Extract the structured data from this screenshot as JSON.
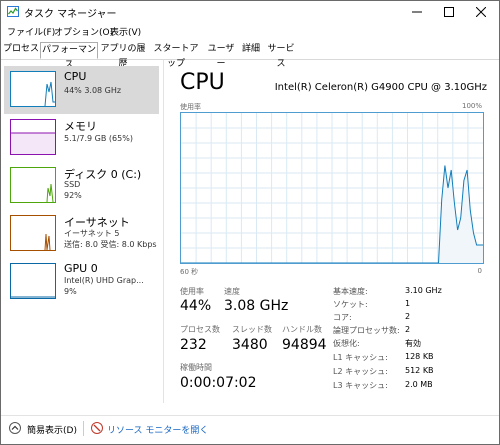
{
  "window": {
    "title": "タスク マネージャー",
    "icon": "task-manager-icon"
  },
  "menu": [
    "ファイル(F)",
    "オプション(O)",
    "表示(V)"
  ],
  "tabs": [
    "プロセス",
    "パフォーマンス",
    "アプリの履歴",
    "スタートアップ",
    "ユーザー",
    "詳細",
    "サービス"
  ],
  "active_tab": "パフォーマンス",
  "sidebar": [
    {
      "name": "CPU",
      "line1": "44%  3.08 GHz",
      "line2": "",
      "color": "#117dbb"
    },
    {
      "name": "メモリ",
      "line1": "5.1/7.9 GB (65%)",
      "line2": "",
      "color": "#8b12ae"
    },
    {
      "name": "ディスク 0 (C:)",
      "line1": "SSD",
      "line2": "92%",
      "color": "#4da60c"
    },
    {
      "name": "イーサネット",
      "line1": "イーサネット 5",
      "line2": "送信: 8.0  受信: 8.0 Kbps",
      "color": "#a74f01"
    },
    {
      "name": "GPU 0",
      "line1": "Intel(R) UHD Grap...",
      "line2": "9%",
      "color": "#0a69a5"
    }
  ],
  "main": {
    "title": "CPU",
    "processor": "Intel(R) Celeron(R) G4900 CPU @ 3.10GHz",
    "graph_top_left": "使用率",
    "graph_top_right": "100%",
    "graph_bottom_left": "60 秒",
    "graph_bottom_right": "0",
    "usage_label": "使用率",
    "usage_value": "44%",
    "speed_label": "速度",
    "speed_value": "3.08 GHz",
    "processes_label": "プロセス数",
    "processes_value": "232",
    "threads_label": "スレッド数",
    "threads_value": "3480",
    "handles_label": "ハンドル数",
    "handles_value": "94894",
    "uptime_label": "稼働時間",
    "uptime_value": "0:00:07:02",
    "details": [
      {
        "k": "基本速度:",
        "v": "3.10 GHz"
      },
      {
        "k": "ソケット:",
        "v": "1"
      },
      {
        "k": "コア:",
        "v": "2"
      },
      {
        "k": "論理プロセッサ数:",
        "v": "2"
      },
      {
        "k": "仮想化:",
        "v": "有効"
      },
      {
        "k": "L1 キャッシュ:",
        "v": "128 KB"
      },
      {
        "k": "L2 キャッシュ:",
        "v": "512 KB"
      },
      {
        "k": "L3 キャッシュ:",
        "v": "2.0 MB"
      }
    ]
  },
  "cpu_history": [
    0,
    0,
    0,
    0,
    0,
    0,
    0,
    0,
    0,
    0,
    0,
    0,
    0,
    0,
    0,
    0,
    0,
    0,
    0,
    0,
    0,
    0,
    0,
    0,
    0,
    0,
    0,
    0,
    0,
    0,
    0,
    0,
    0,
    0,
    0,
    0,
    0,
    0,
    0,
    0,
    0,
    0,
    0,
    0,
    0,
    0,
    0,
    0,
    0,
    0,
    0,
    0,
    0,
    0,
    0,
    0,
    0,
    0,
    0,
    0,
    0,
    0,
    0,
    0,
    0,
    0,
    0,
    0,
    0,
    0,
    0,
    0,
    0,
    0,
    0,
    0,
    0,
    0,
    0,
    0,
    0,
    0,
    42,
    65,
    50,
    62,
    40,
    22,
    30,
    55,
    62,
    35,
    20,
    12,
    12,
    12
  ],
  "footer": {
    "fewer_details": "簡易表示(D)",
    "resource_monitor": "リソース モニターを開く"
  }
}
